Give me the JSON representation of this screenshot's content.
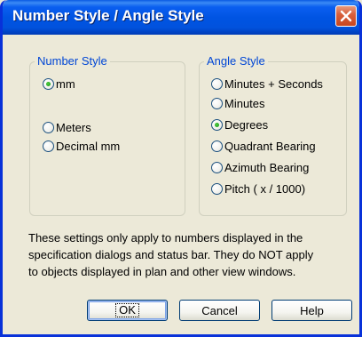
{
  "window": {
    "title": "Number Style / Angle Style",
    "close_icon": "close-icon",
    "close_color": "#d8603d"
  },
  "number_style": {
    "label": "Number Style",
    "options": [
      {
        "label": "mm",
        "selected": true
      },
      {
        "label": "Meters",
        "selected": false
      },
      {
        "label": "Decimal mm",
        "selected": false
      }
    ]
  },
  "angle_style": {
    "label": "Angle Style",
    "options": [
      {
        "label": "Minutes + Seconds",
        "selected": false
      },
      {
        "label": "Minutes",
        "selected": false
      },
      {
        "label": "Degrees",
        "selected": true
      },
      {
        "label": "Quadrant Bearing",
        "selected": false
      },
      {
        "label": "Azimuth Bearing",
        "selected": false
      },
      {
        "label": "Pitch ( x / 1000)",
        "selected": false
      }
    ]
  },
  "info": {
    "line1": "These settings only apply to numbers displayed in the",
    "line2": "specification dialogs and status bar. They do NOT apply",
    "line3": "to objects displayed in plan and other view windows."
  },
  "buttons": {
    "ok_mnemonic": "O",
    "ok_rest": "K",
    "cancel": "Cancel",
    "help_mnemonic": "H",
    "help_rest": "elp"
  },
  "colors": {
    "title_bar": "#0054e3",
    "group_label": "#0046d5",
    "selected_dot": "#21a121",
    "dialog_bg": "#ece9d8"
  }
}
